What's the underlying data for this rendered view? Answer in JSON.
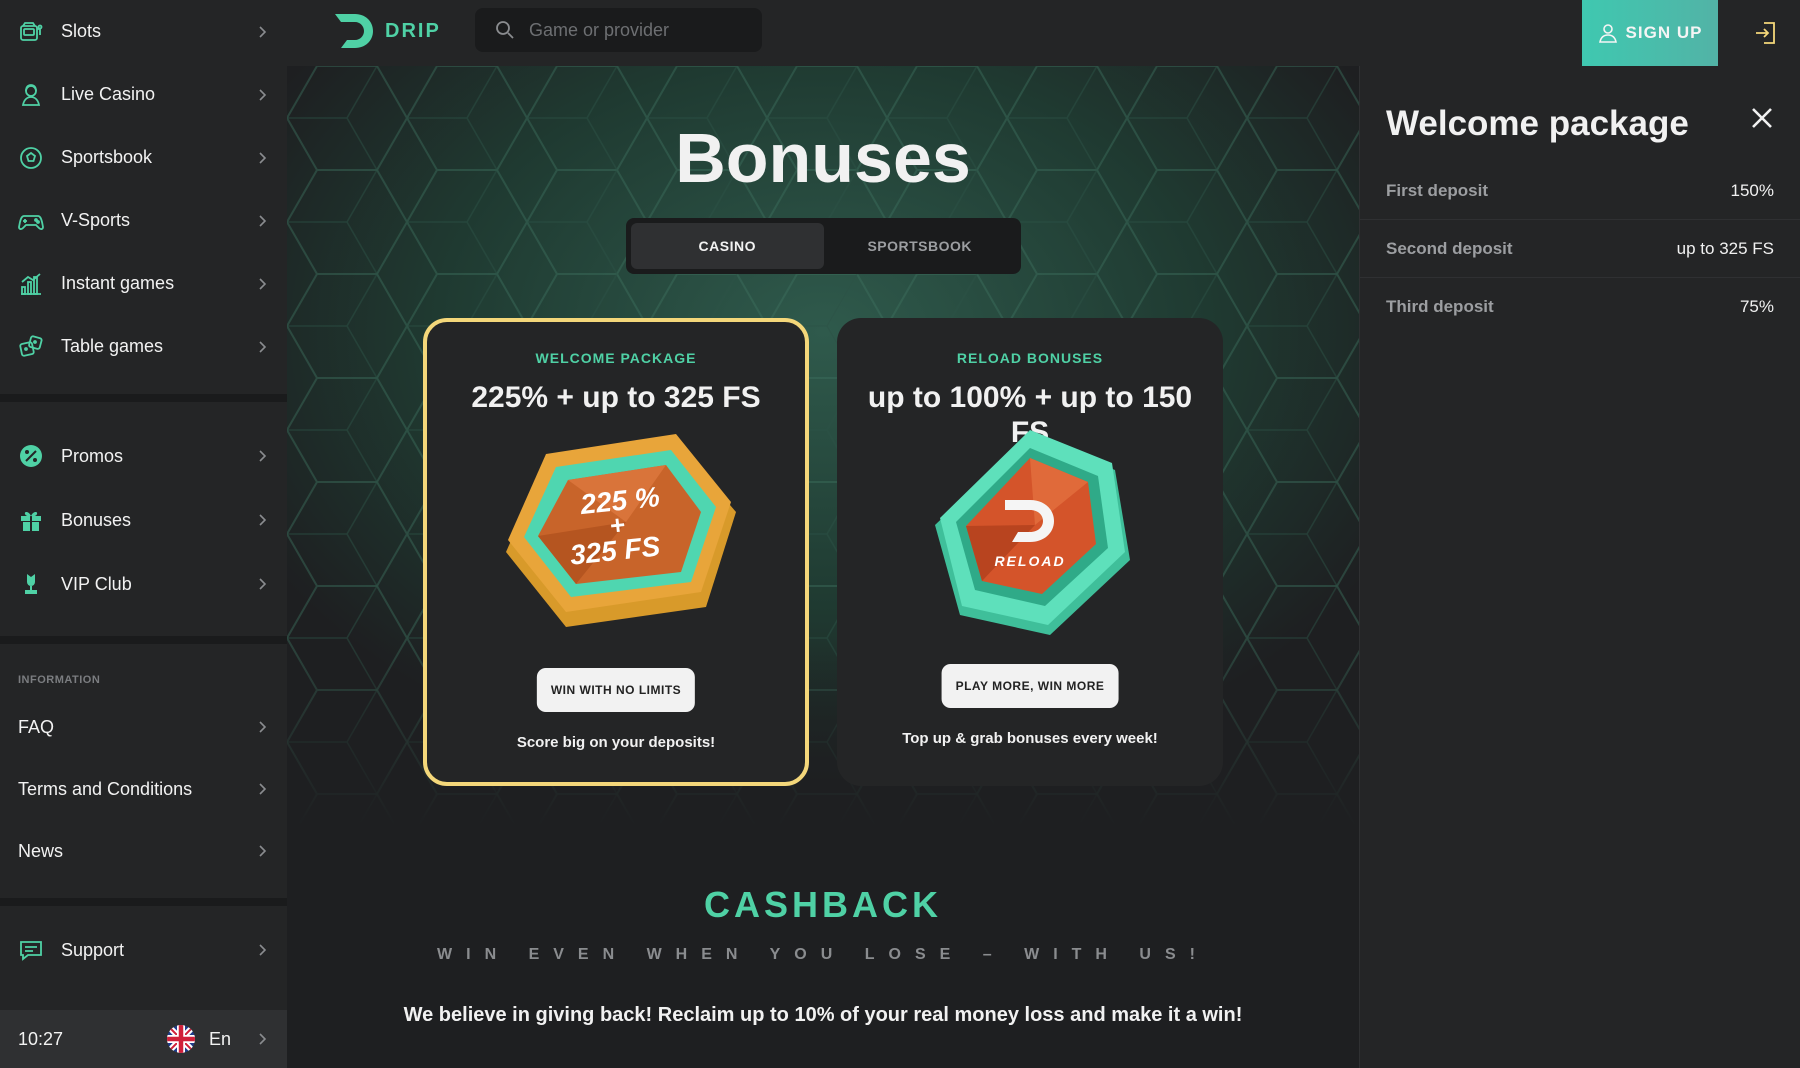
{
  "sidebar": {
    "main_items": [
      {
        "label": "Slots",
        "icon": "slot-machine-icon"
      },
      {
        "label": "Live Casino",
        "icon": "live-dealer-icon"
      },
      {
        "label": "Sportsbook",
        "icon": "soccer-ball-icon"
      },
      {
        "label": "V-Sports",
        "icon": "gamepad-icon"
      },
      {
        "label": "Instant games",
        "icon": "bar-chart-icon"
      },
      {
        "label": "Table games",
        "icon": "dice-icon"
      }
    ],
    "promo_items": [
      {
        "label": "Promos",
        "icon": "percent-icon"
      },
      {
        "label": "Bonuses",
        "icon": "gift-icon"
      },
      {
        "label": "VIP Club",
        "icon": "trophy-icon"
      }
    ],
    "information_heading": "INFORMATION",
    "info_items": [
      {
        "label": "FAQ"
      },
      {
        "label": "Terms and Conditions"
      },
      {
        "label": "News"
      }
    ],
    "support_label": "Support",
    "time": "10:27",
    "language": "En"
  },
  "header": {
    "logo_text": "DRIP",
    "search_placeholder": "Game or provider",
    "signup_label": "SIGN UP"
  },
  "main": {
    "title": "Bonuses",
    "tabs": [
      {
        "label": "CASINO",
        "active": true
      },
      {
        "label": "SPORTSBOOK",
        "active": false
      }
    ],
    "cards": [
      {
        "label": "WELCOME PACKAGE",
        "title": "225% + up to 325 FS",
        "art_line1": "225 %",
        "art_line2": "+",
        "art_line3": "325 FS",
        "button": "WIN WITH NO LIMITS",
        "description": "Score big on your deposits!"
      },
      {
        "label": "RELOAD BONUSES",
        "title": "up to 100% + up to 150 FS",
        "art_text": "RELOAD",
        "button": "PLAY MORE, WIN MORE",
        "description": "Top up & grab bonuses every week!"
      }
    ],
    "cashback": {
      "title": "CASHBACK",
      "subtitle": "WIN EVEN WHEN YOU LOSE – WITH US!",
      "description": "We believe in giving back! Reclaim up to 10% of your real money loss and make it a win!"
    }
  },
  "panel": {
    "title": "Welcome package",
    "rows": [
      {
        "label": "First deposit",
        "value": "150%"
      },
      {
        "label": "Second deposit",
        "value": "up to 325 FS"
      },
      {
        "label": "Third deposit",
        "value": "75%"
      }
    ]
  },
  "colors": {
    "accent": "#4fd1a5",
    "highlight_border": "#f4d77a",
    "background": "#1e1f21",
    "sidebar": "#242526"
  }
}
